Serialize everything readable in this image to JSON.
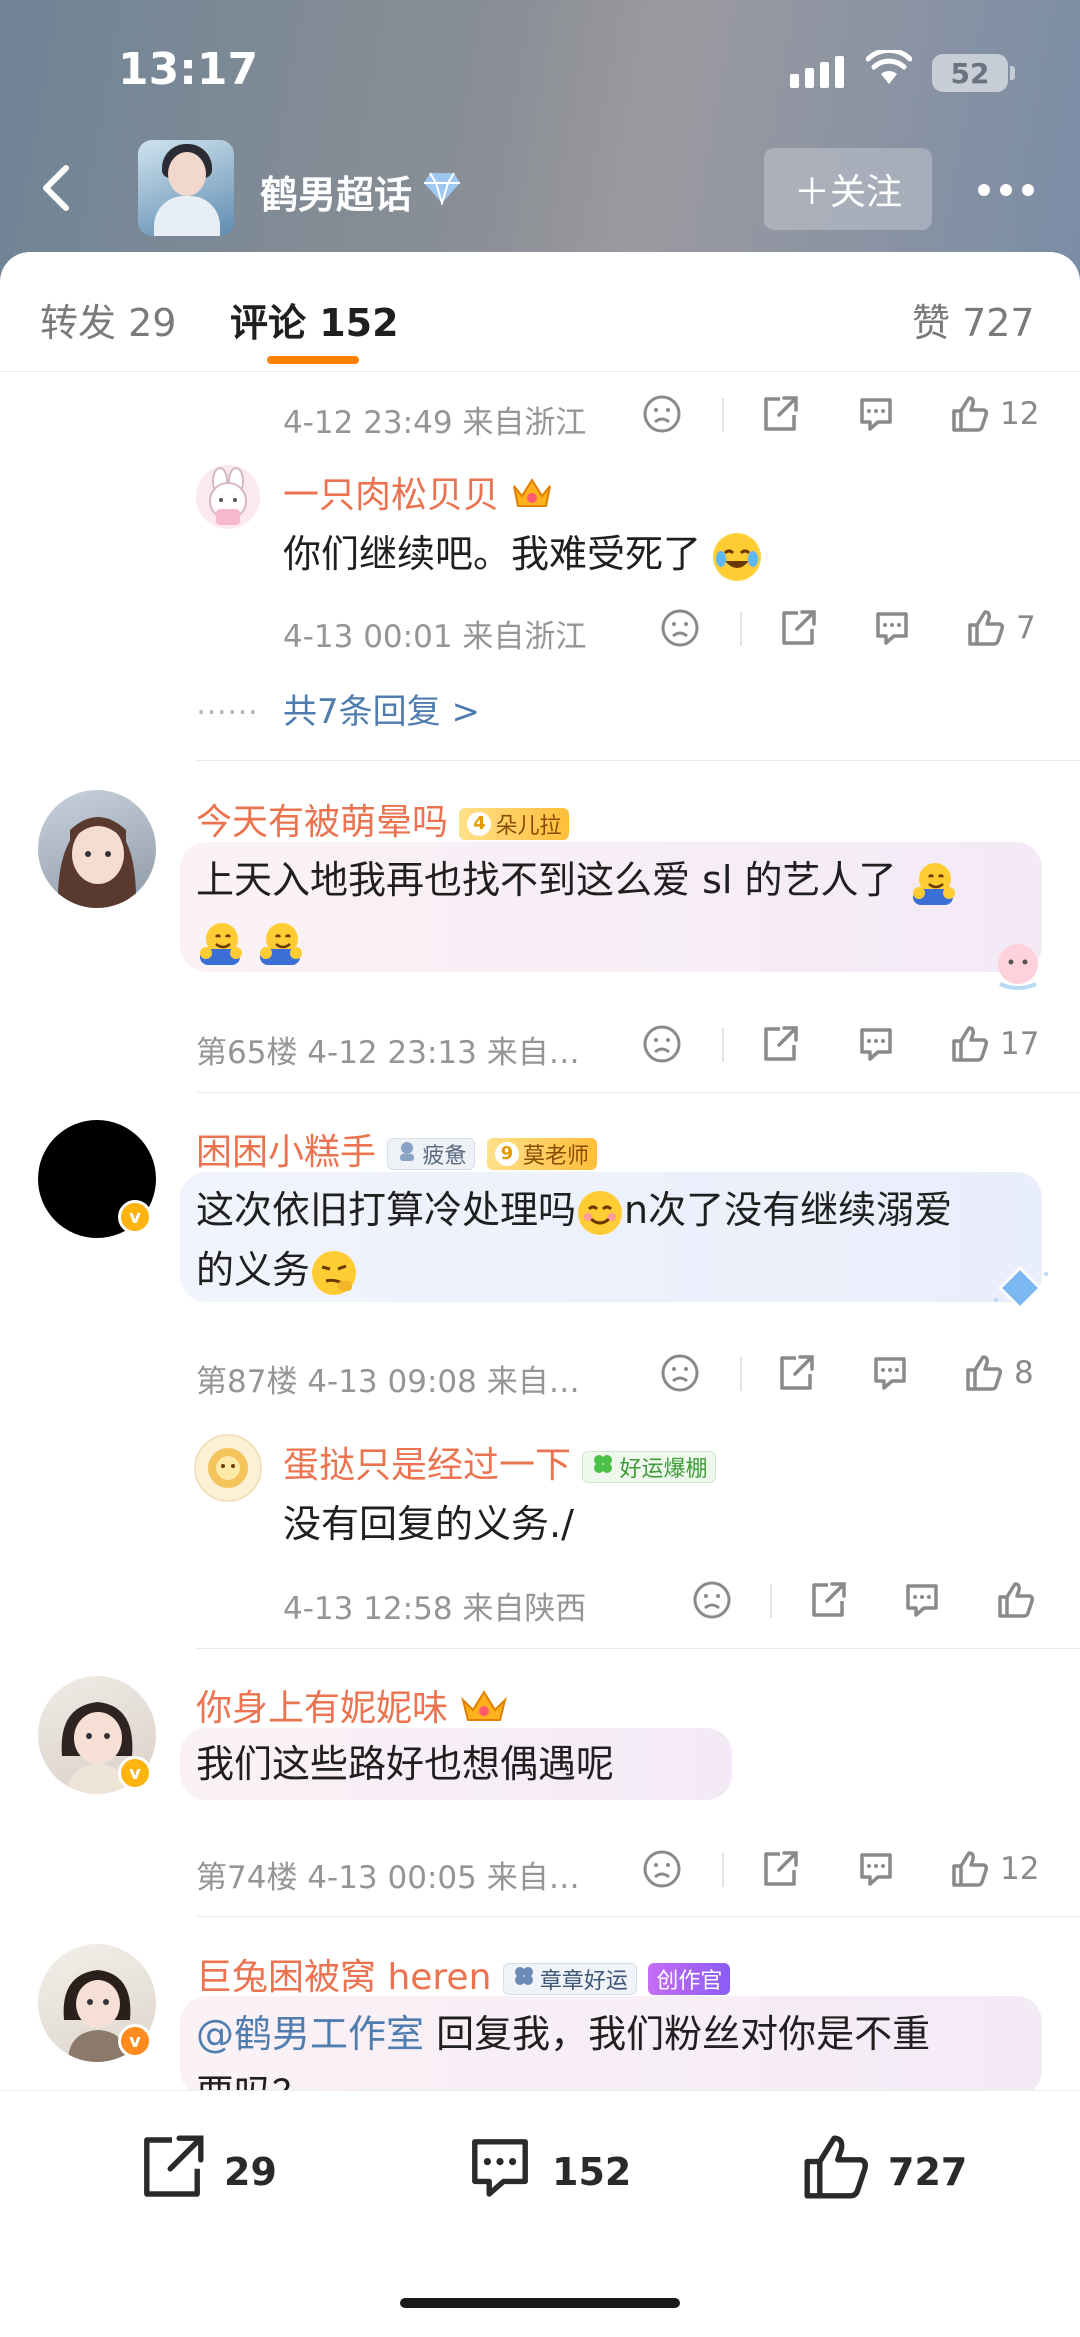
{
  "status": {
    "time": "13:17",
    "battery": "52"
  },
  "header": {
    "title": "鹤男超话",
    "follow_label": "＋关注"
  },
  "tabs": {
    "repost": "转发 29",
    "comment": "评论 152",
    "like": "赞 727"
  },
  "thread1": {
    "meta": "4-12 23:49  来自浙江",
    "like_count": "12",
    "reply": {
      "nick": "一只肉松贝贝",
      "text": "你们继续吧。我难受死了",
      "meta": "4-13 00:01  来自浙江",
      "like_count": "7"
    },
    "ellipsis": "……",
    "more_replies": "共7条回复 >"
  },
  "comments": [
    {
      "nick": "今天有被萌晕吗",
      "badge": "朵儿拉",
      "badge_level": "4",
      "text_line1": "上天入地我再也找不到这么爱 sl 的艺人了",
      "meta": "第65楼  4-12 23:13  来自…",
      "like_count": "17"
    },
    {
      "nick": "困困小糕手",
      "badge_a": "疲惫",
      "badge_b": "莫老师",
      "badge_level": "9",
      "text_line1": "这次依旧打算冷处理吗",
      "text_line1b": "n次了没有继续溺爱",
      "text_line2": "的义务",
      "meta": "第87楼  4-13 09:08  来自…",
      "like_count": "8",
      "verified": "v",
      "reply": {
        "nick": "蛋挞只是经过一下",
        "badge": "好运爆棚",
        "text": "没有回复的义务./",
        "meta": "4-13 12:58  来自陕西"
      }
    },
    {
      "nick": "你身上有妮妮味",
      "text": "我们这些路好也想偶遇呢",
      "meta": "第74楼  4-13 00:05  来自…",
      "like_count": "12",
      "verified": "v"
    },
    {
      "nick": "巨兔困被窝 heren",
      "badge_a": "章章好运",
      "badge_b": "创作官",
      "mention": "@鹤男工作室",
      "text": " 回复我，我们粉丝对你是不重",
      "text_line2": "要吗？",
      "verified": "v"
    }
  ],
  "bottom": {
    "repost_count": "29",
    "comment_count": "152",
    "like_count": "727"
  },
  "colors": {
    "accent": "#ff8200",
    "nickname": "#eb7350",
    "link": "#507daf"
  }
}
